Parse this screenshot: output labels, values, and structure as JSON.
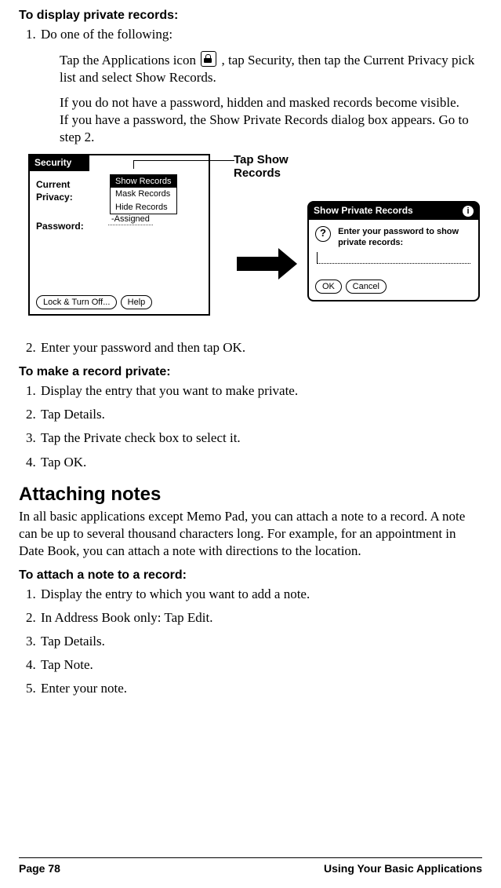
{
  "proc1": {
    "heading": "To display private records:",
    "steps": [
      "Do one of the following:"
    ],
    "sub1a": "Tap the Applications icon ",
    "sub1b": ", tap Security, then tap the Current Privacy pick list and select Show Records.",
    "sub2a": "If you do not have a password, hidden and masked records become visible.",
    "sub2b": "If you have a password, the Show Private Records dialog box appears. Go to step 2.",
    "step2": "Enter your password and then tap OK."
  },
  "fig": {
    "securityTitle": "Security",
    "curPriv1": "Current",
    "curPriv2": "Privacy:",
    "options": [
      "Show Records",
      "Mask Records",
      "Hide Records"
    ],
    "passwordLabel": "Password:",
    "passwordValue": "-Assigned",
    "lockBtn": "Lock & Turn Off...",
    "helpBtn": "Help",
    "callout1": "Tap Show",
    "callout2": "Records",
    "dlgTitle": "Show Private Records",
    "dlgMsg": "Enter your password to show private records:",
    "ok": "OK",
    "cancel": "Cancel"
  },
  "proc2": {
    "heading": "To make a record private:",
    "steps": [
      "Display the entry that you want to make private.",
      "Tap Details.",
      "Tap the Private check box to select it.",
      "Tap OK."
    ]
  },
  "section": {
    "heading": "Attaching notes",
    "body": "In all basic applications except Memo Pad, you can attach a note to a record. A note can be up to several thousand characters long. For example, for an appointment in Date Book, you can attach a note with directions to the location."
  },
  "proc3": {
    "heading": "To attach a note to a record:",
    "steps": [
      "Display the entry to which you want to add a note.",
      "In Address Book only: Tap Edit.",
      "Tap Details.",
      "Tap Note.",
      "Enter your note."
    ]
  },
  "footer": {
    "left": "Page 78",
    "right": "Using Your Basic Applications"
  }
}
